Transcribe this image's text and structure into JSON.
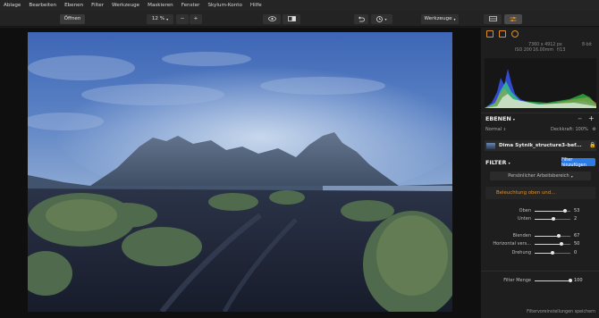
{
  "menu": [
    "Ablage",
    "Bearbeiten",
    "Ebenen",
    "Filter",
    "Werkzeuge",
    "Maskieren",
    "Fenster",
    "Skylum-Konto",
    "Hilfe"
  ],
  "toolbar": {
    "open_label": "Öffnen",
    "zoom_value": "12 %",
    "zoom_out": "−",
    "zoom_in": "+",
    "tools_label": "Werkzeuge"
  },
  "panel": {
    "image_size": "7360 x 4912 px",
    "bit_depth": "8-bit",
    "iso": "ISO 200",
    "focal": "16.00mm",
    "aperture": "f/13",
    "layers_title": "EBENEN",
    "blend_mode": "Normal",
    "opacity": "Deckkraft: 100%",
    "layer_name": "Dima Sytnik_structure3-bef...",
    "filter_title": "FILTER",
    "add_filter": "Filter hinzufügen",
    "workspace": "Persönlicher Arbeitsbereich",
    "filter_name": "Beleuchtung oben und...",
    "sliders": [
      {
        "label": "Oben",
        "value": "53",
        "fraction": 0.84
      },
      {
        "label": "Unten",
        "value": "2",
        "fraction": 0.52
      },
      {
        "label": "Blenden",
        "value": "67",
        "fraction": 0.67
      },
      {
        "label": "Horizontal vers...",
        "value": "50",
        "fraction": 0.75
      },
      {
        "label": "Drehung",
        "value": "0",
        "fraction": 0.5
      }
    ],
    "amount": {
      "label": "Filter Menge",
      "value": "100",
      "fraction": 1.0
    },
    "save_label": "Filtervoreinstellungen speichern"
  },
  "colors": {
    "accent": "#e0902a",
    "primary_button": "#2e7be5"
  }
}
